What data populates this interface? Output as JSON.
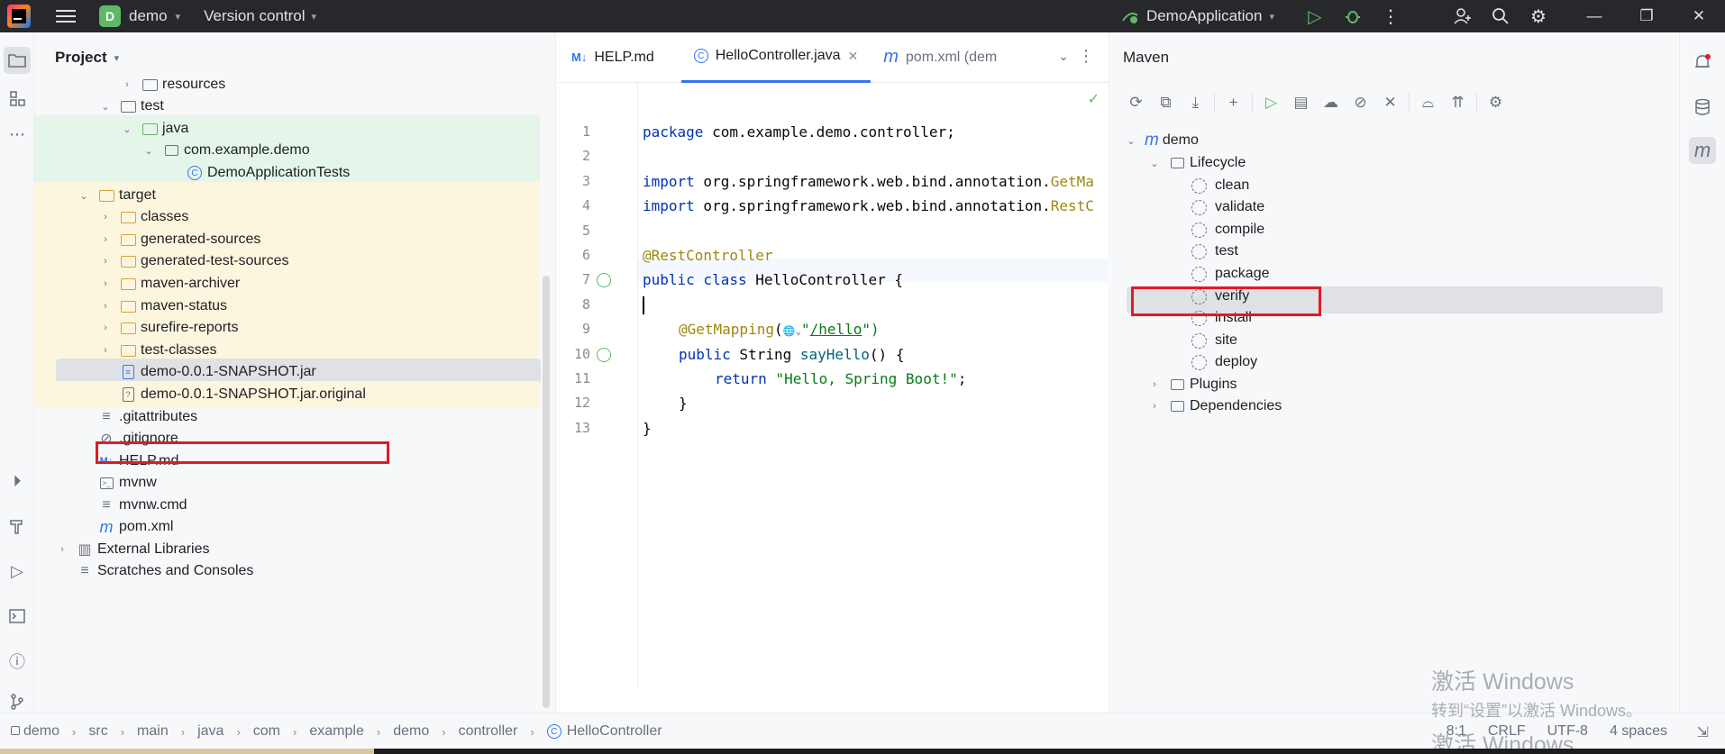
{
  "titlebar": {
    "project_badge": "D",
    "project_name": "demo",
    "vcs_label": "Version control",
    "run_config": "DemoApplication"
  },
  "project_panel": {
    "title": "Project",
    "tree": [
      {
        "label": "resources",
        "icon": "folder-icon"
      },
      {
        "label": "test",
        "icon": "folder-icon"
      },
      {
        "label": "java",
        "icon": "folder-icon"
      },
      {
        "label": "com.example.demo",
        "icon": "package-icon"
      },
      {
        "label": "DemoApplicationTests",
        "icon": "class-icon"
      },
      {
        "label": "target",
        "icon": "folder-icon"
      },
      {
        "label": "classes",
        "icon": "folder-icon"
      },
      {
        "label": "generated-sources",
        "icon": "folder-icon"
      },
      {
        "label": "generated-test-sources",
        "icon": "folder-icon"
      },
      {
        "label": "maven-archiver",
        "icon": "folder-icon"
      },
      {
        "label": "maven-status",
        "icon": "folder-icon"
      },
      {
        "label": "surefire-reports",
        "icon": "folder-icon"
      },
      {
        "label": "test-classes",
        "icon": "folder-icon"
      },
      {
        "label": "demo-0.0.1-SNAPSHOT.jar",
        "icon": "jar-icon"
      },
      {
        "label": "demo-0.0.1-SNAPSHOT.jar.original",
        "icon": "unknown-file-icon"
      },
      {
        "label": ".gitattributes",
        "icon": "text-file-icon"
      },
      {
        "label": ".gitignore",
        "icon": "gitignore-icon"
      },
      {
        "label": "HELP.md",
        "icon": "markdown-icon"
      },
      {
        "label": "mvnw",
        "icon": "shell-script-icon"
      },
      {
        "label": "mvnw.cmd",
        "icon": "text-file-icon"
      },
      {
        "label": "pom.xml",
        "icon": "maven-icon"
      },
      {
        "label": "External Libraries",
        "icon": "library-icon"
      },
      {
        "label": "Scratches and Consoles",
        "icon": "scratches-icon"
      }
    ]
  },
  "editor": {
    "tabs": [
      {
        "label": "HELP.md",
        "badge": "M↓"
      },
      {
        "label": "HelloController.java",
        "badge": "C"
      },
      {
        "label": "pom.xml (dem",
        "badge": "m"
      }
    ],
    "line_numbers": [
      "1",
      "2",
      "3",
      "4",
      "5",
      "6",
      "7",
      "8",
      "9",
      "10",
      "11",
      "12",
      "13"
    ],
    "code": {
      "l1_kw": "package",
      "l1_rest": " com.example.demo.controller;",
      "l3_kw": "import",
      "l3_rest": " org.springframework.web.bind.annotation.",
      "l3_tail": "GetMa",
      "l4_kw": "import",
      "l4_rest": " org.springframework.web.bind.annotation.",
      "l4_tail": "RestC",
      "l6_ann": "@RestController",
      "l7_kw": "public class",
      "l7_rest": " HelloController {",
      "l9_ann": "@GetMapping",
      "l9_open": "(",
      "l9_globe": "🌐",
      "l9_chev": "⌄",
      "l9_q1": "\"",
      "l9_path": "/hello",
      "l9_q2": "\")",
      "l10_kw": "public",
      "l10_type": " String ",
      "l10_fn": "sayHello",
      "l10_rest": "() {",
      "l11_kw": "return",
      "l11_str": " \"Hello, Spring Boot!\"",
      "l11_end": ";",
      "l12": "}",
      "l13": "}"
    }
  },
  "maven": {
    "title": "Maven",
    "root": "demo",
    "lifecycle_label": "Lifecycle",
    "phases": [
      "clean",
      "validate",
      "compile",
      "test",
      "package",
      "verify",
      "install",
      "site",
      "deploy"
    ],
    "plugins_label": "Plugins",
    "dependencies_label": "Dependencies"
  },
  "statusbar": {
    "breadcrumbs": [
      "demo",
      "src",
      "main",
      "java",
      "com",
      "example",
      "demo",
      "controller",
      "HelloController"
    ],
    "position": "8:1",
    "line_ending": "CRLF",
    "encoding": "UTF-8",
    "indent": "4 spaces"
  },
  "watermark": {
    "line1": "激活 Windows",
    "line2": "转到“设置”以激活 Windows。",
    "line3": "激活 Windows"
  },
  "colors": {
    "accent": "#3574f0",
    "highlight_box": "#e01b24",
    "run_green": "#5fb865"
  }
}
